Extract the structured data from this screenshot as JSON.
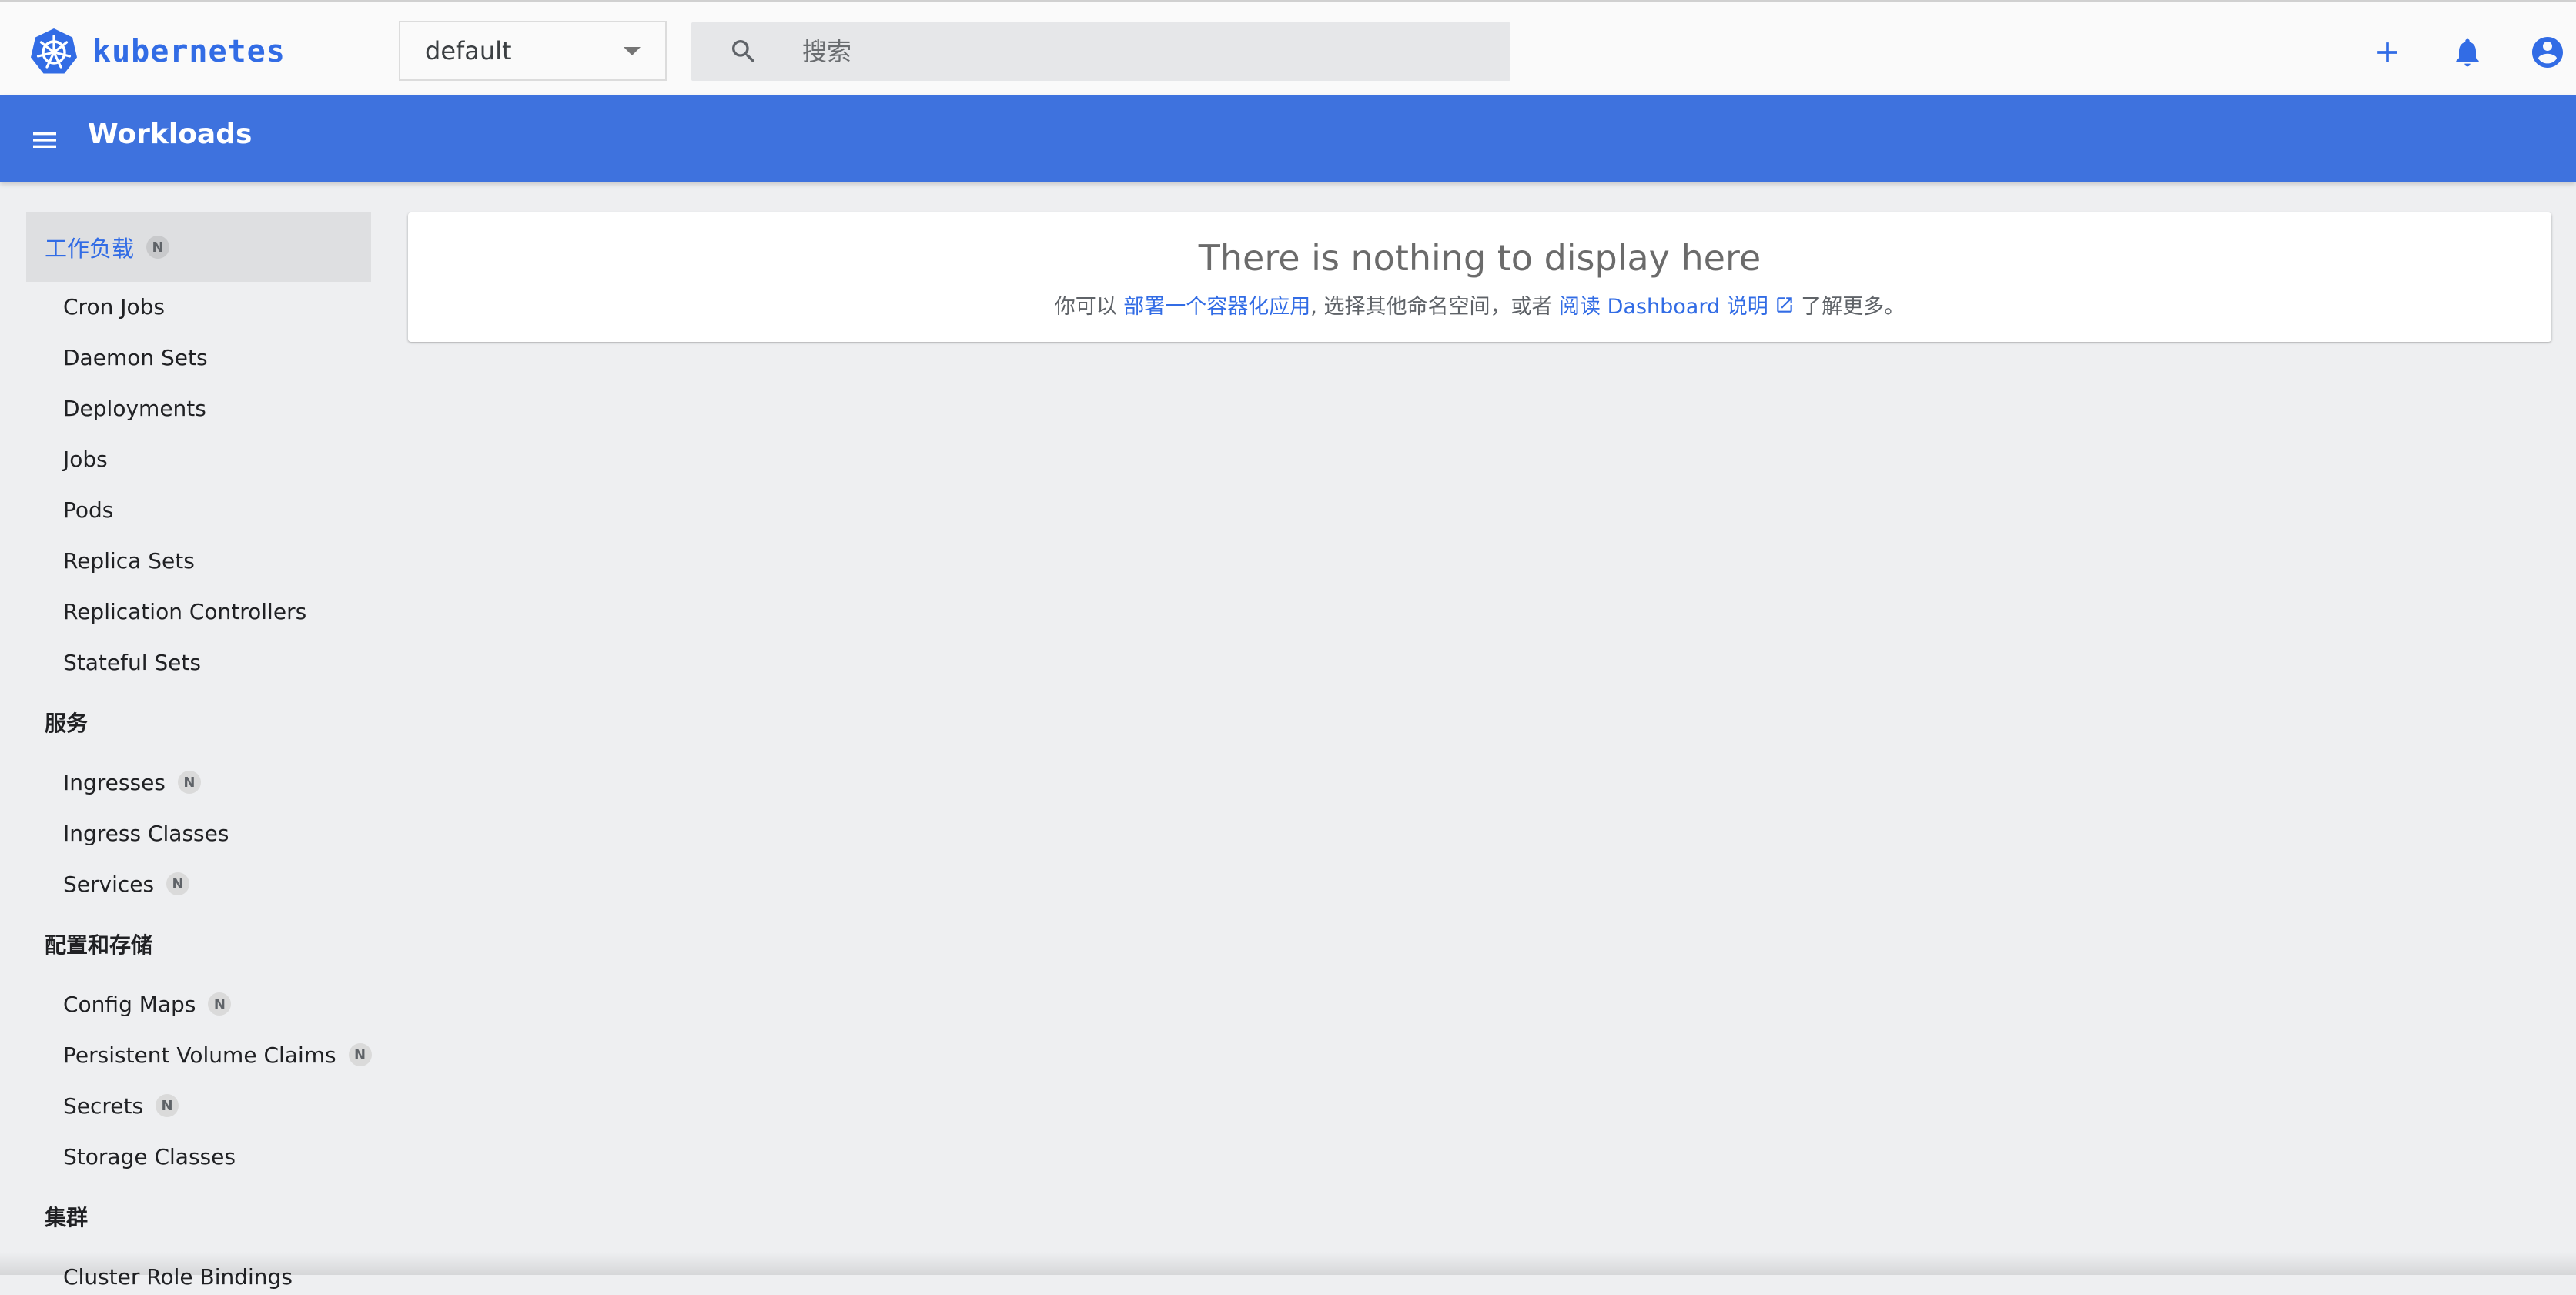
{
  "brand": {
    "name": "kubernetes",
    "color": "#326ce5"
  },
  "header": {
    "namespace": {
      "selected": "default"
    },
    "search": {
      "placeholder": "搜索",
      "value": ""
    },
    "actions": {
      "add_icon": "plus-icon",
      "notifications_icon": "bell-icon",
      "account_icon": "account-circle-icon"
    }
  },
  "appbar": {
    "title": "Workloads",
    "background": "#3e72de"
  },
  "sidebar": {
    "active": {
      "label": "工作负载",
      "badge": "N"
    },
    "workloads": [
      "Cron Jobs",
      "Daemon Sets",
      "Deployments",
      "Jobs",
      "Pods",
      "Replica Sets",
      "Replication Controllers",
      "Stateful Sets"
    ],
    "service": {
      "title": "服务",
      "items": [
        {
          "label": "Ingresses",
          "badge": "N"
        },
        {
          "label": "Ingress Classes"
        },
        {
          "label": "Services",
          "badge": "N"
        }
      ]
    },
    "config": {
      "title": "配置和存储",
      "items": [
        {
          "label": "Config Maps",
          "badge": "N"
        },
        {
          "label": "Persistent Volume Claims",
          "badge": "N"
        },
        {
          "label": "Secrets",
          "badge": "N"
        },
        {
          "label": "Storage Classes"
        }
      ]
    },
    "cluster": {
      "title": "集群",
      "items": [
        {
          "label": "Cluster Role Bindings"
        }
      ]
    }
  },
  "empty_state": {
    "title": "There is nothing to display here",
    "text_before": "你可以 ",
    "deploy_link": "部署一个容器化应用",
    "text_middle": ", 选择其他命名空间，或者 ",
    "docs_link": "阅读 Dashboard 说明",
    "text_after": " 了解更多。"
  }
}
